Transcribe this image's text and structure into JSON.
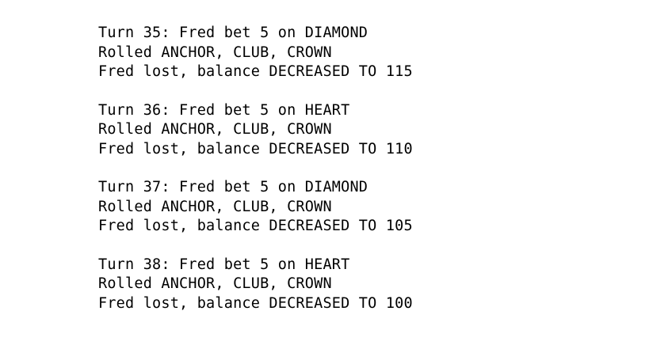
{
  "log": {
    "turns": [
      {
        "bet_line": "Turn 35: Fred bet 5 on DIAMOND",
        "roll_line": "Rolled ANCHOR, CLUB, CROWN",
        "result_line": "Fred lost, balance DECREASED TO 115"
      },
      {
        "bet_line": "Turn 36: Fred bet 5 on HEART",
        "roll_line": "Rolled ANCHOR, CLUB, CROWN",
        "result_line": "Fred lost, balance DECREASED TO 110"
      },
      {
        "bet_line": "Turn 37: Fred bet 5 on DIAMOND",
        "roll_line": "Rolled ANCHOR, CLUB, CROWN",
        "result_line": "Fred lost, balance DECREASED TO 105"
      },
      {
        "bet_line": "Turn 38: Fred bet 5 on HEART",
        "roll_line": "Rolled ANCHOR, CLUB, CROWN",
        "result_line": "Fred lost, balance DECREASED TO 100"
      }
    ]
  }
}
